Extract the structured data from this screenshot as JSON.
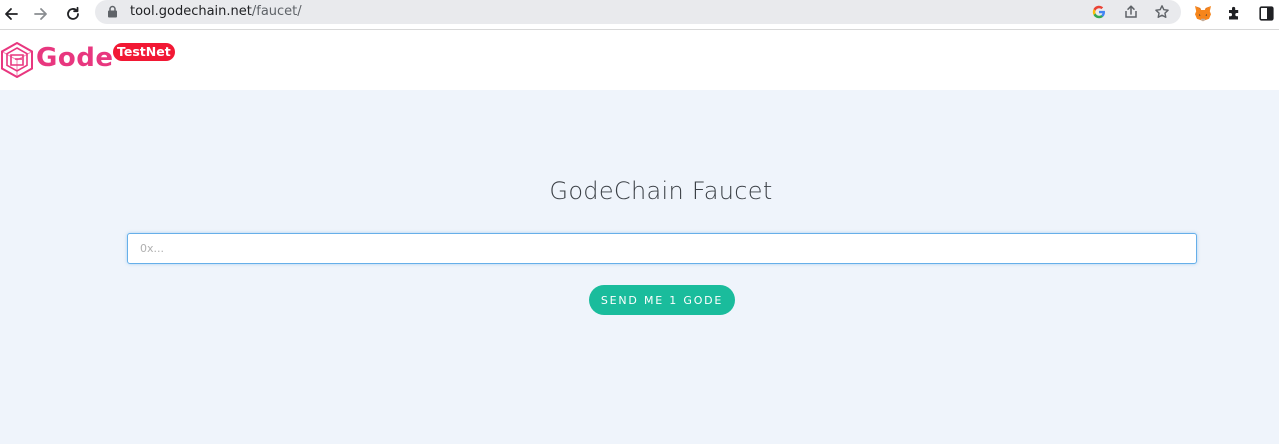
{
  "browser": {
    "url_host": "tool.godechain.net",
    "url_path": "/faucet/",
    "icons": [
      "back-icon",
      "forward-icon",
      "reload-icon",
      "lock-icon",
      "google-icon",
      "share-icon",
      "bookmark-star-icon",
      "metamask-fox-icon",
      "extensions-puzzle-icon",
      "side-panel-icon"
    ]
  },
  "header": {
    "logo_text": "Gode",
    "badge_text": "TestNet"
  },
  "faucet": {
    "title": "GodeChain Faucet",
    "address_placeholder": "0x...",
    "address_value": "",
    "send_button_label": "SEND ME 1 GODE"
  },
  "colors": {
    "brand_pink": "#e8377f",
    "badge_red": "#f21834",
    "button_teal": "#1abc9c",
    "page_background": "#eff4fb",
    "input_focus_border": "#66afe9"
  }
}
